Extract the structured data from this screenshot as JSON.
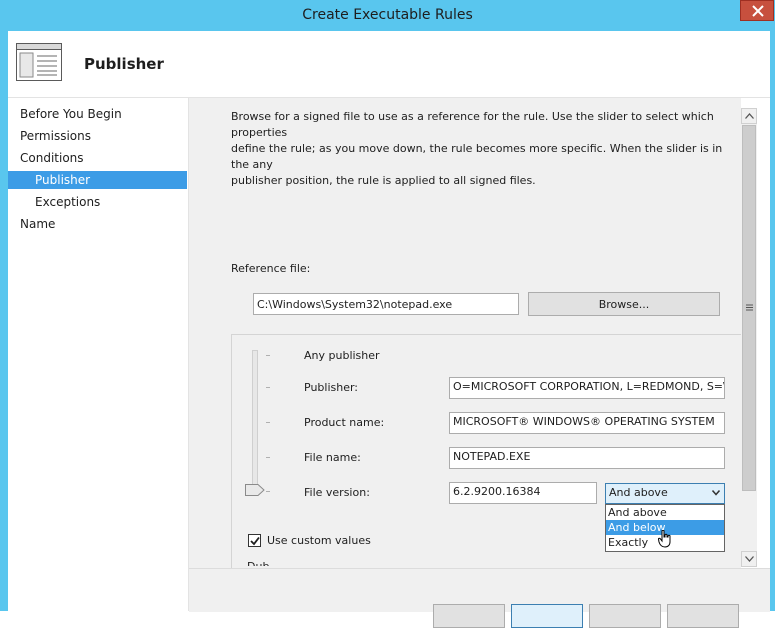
{
  "window": {
    "title": "Create Executable Rules"
  },
  "header": {
    "title": "Publisher",
    "icon": "wizard-page-icon"
  },
  "nav": {
    "items": [
      {
        "label": "Before You Begin",
        "level": 0,
        "selected": false
      },
      {
        "label": "Permissions",
        "level": 0,
        "selected": false
      },
      {
        "label": "Conditions",
        "level": 0,
        "selected": false
      },
      {
        "label": "Publisher",
        "level": 1,
        "selected": true
      },
      {
        "label": "Exceptions",
        "level": 1,
        "selected": false
      },
      {
        "label": "Name",
        "level": 0,
        "selected": false
      }
    ]
  },
  "content": {
    "description": "Browse for a signed file to use as a reference for the rule. Use the slider to select which properties\ndefine the rule; as you move down, the rule becomes more specific. When the slider is in the any\npublisher position, the rule is applied to all signed files.",
    "reference_label": "Reference file:",
    "reference_value": "C:\\Windows\\System32\\notepad.exe",
    "browse_label": "Browse...",
    "any_publisher_label": "Any publisher",
    "publisher_label": "Publisher:",
    "publisher_value": "O=MICROSOFT CORPORATION, L=REDMOND, S=\\",
    "product_label": "Product name:",
    "product_value": "MICROSOFT® WINDOWS® OPERATING SYSTEM",
    "filename_label": "File name:",
    "filename_value": "NOTEPAD.EXE",
    "fileversion_label": "File version:",
    "fileversion_value": "6.2.9200.16384",
    "version_select": {
      "selected": "And above",
      "options": [
        "And above",
        "And below",
        "Exactly"
      ],
      "hovered": "And below"
    },
    "custom_values_label": "Use custom values",
    "custom_values_checked": true,
    "partial_text": "Dub"
  },
  "colors": {
    "title_bar": "#59c6ee",
    "selection": "#3c9ce6",
    "close": "#c7503e"
  }
}
